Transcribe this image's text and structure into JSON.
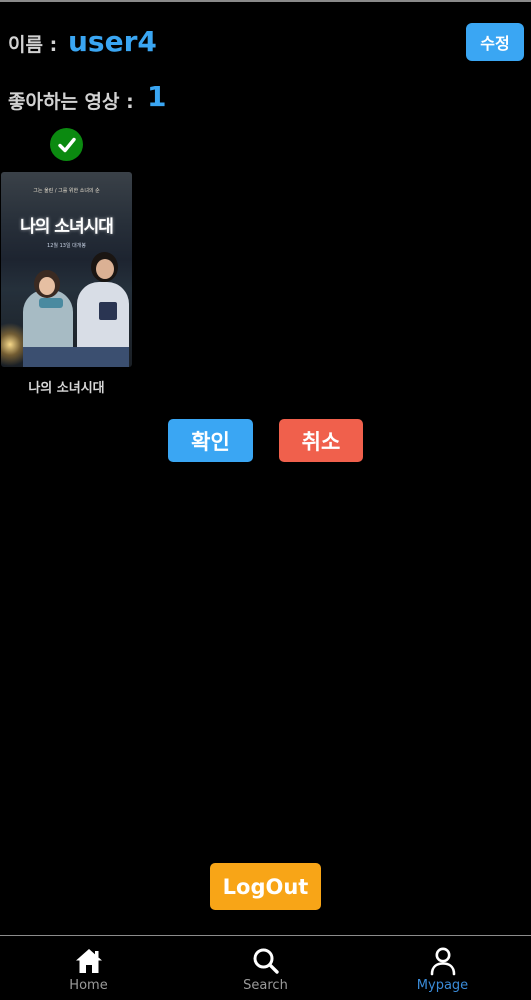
{
  "profile": {
    "name_label": "이름 :",
    "name_value": "user4",
    "edit_label": "수정",
    "likes_label": "좋아하는 영상 :",
    "likes_count": "1"
  },
  "liked_videos": [
    {
      "title": "나의 소녀시대",
      "selected": true,
      "poster": {
        "headline": "나의 소녀시대",
        "subtext": "그는 울린 / 그를 위한 소녀의 순",
        "tagline": "12월 13일 대개봉"
      }
    }
  ],
  "actions": {
    "confirm_label": "확인",
    "cancel_label": "취소",
    "logout_label": "LogOut"
  },
  "tabbar": {
    "home_label": "Home",
    "search_label": "Search",
    "mypage_label": "Mypage",
    "active": "Mypage"
  },
  "colors": {
    "accent_blue": "#3aa6f3",
    "cancel_red": "#f0604c",
    "logout_orange": "#f8a517",
    "check_green": "#0b8a10",
    "tab_active": "#3a8bd8",
    "background": "#000000"
  }
}
